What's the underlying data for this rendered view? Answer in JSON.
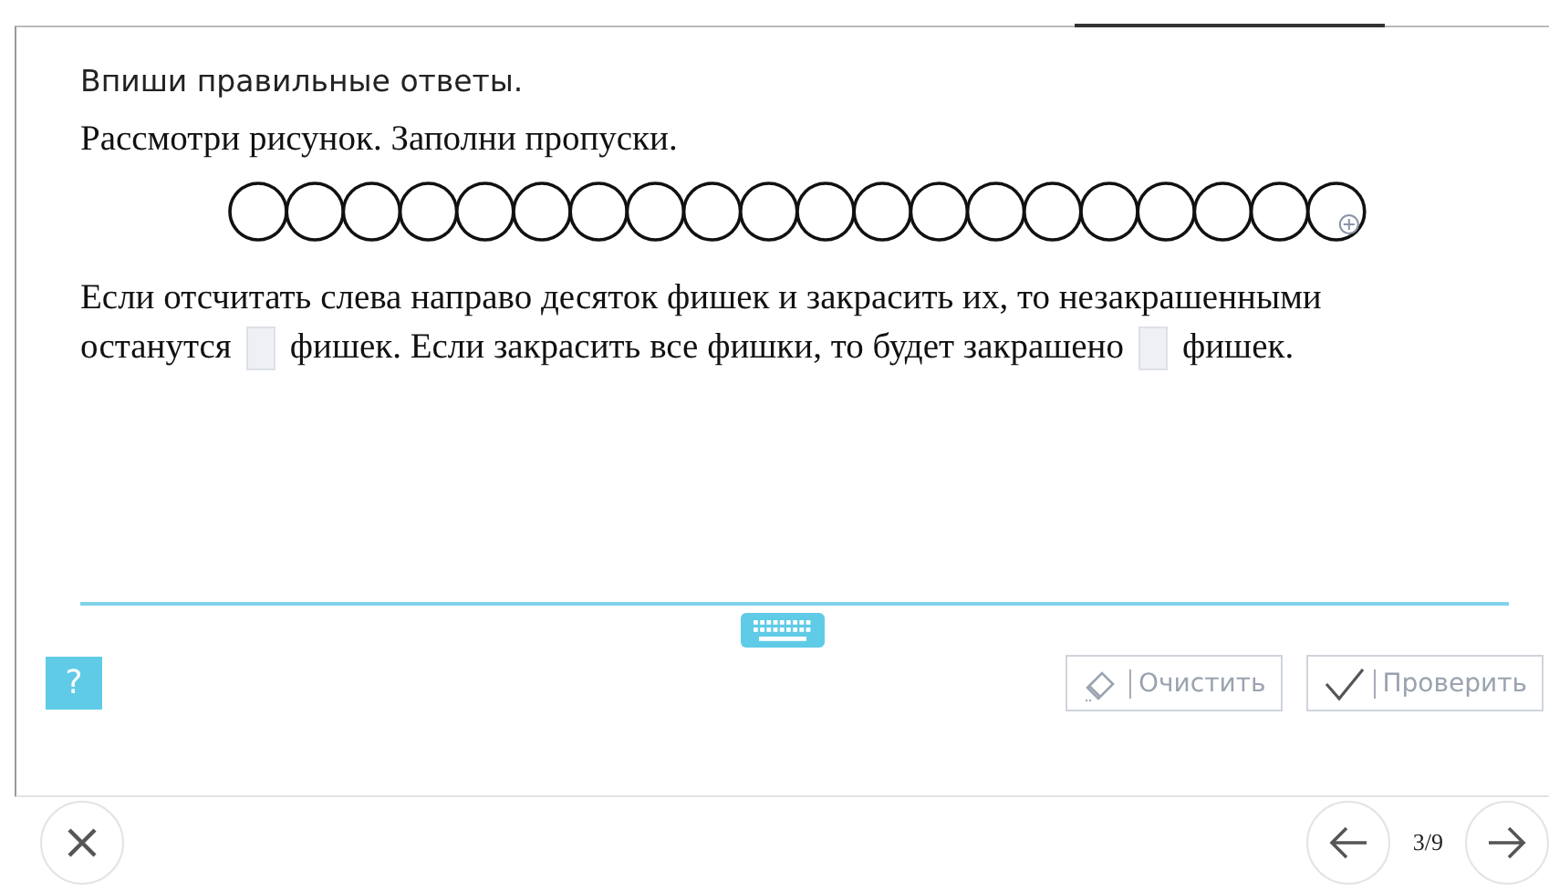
{
  "instruction": "Впиши правильные ответы.",
  "task": {
    "prompt": "Рассмотри рисунок. Заполни пропуски.",
    "counters": [
      {
        "filled": false
      },
      {
        "filled": false
      },
      {
        "filled": false
      },
      {
        "filled": false
      },
      {
        "filled": false
      },
      {
        "filled": false
      },
      {
        "filled": false
      },
      {
        "filled": false
      },
      {
        "filled": false
      },
      {
        "filled": false
      },
      {
        "filled": false
      },
      {
        "filled": false
      },
      {
        "filled": false
      },
      {
        "filled": false
      },
      {
        "filled": false
      },
      {
        "filled": false
      },
      {
        "filled": false
      },
      {
        "filled": false
      },
      {
        "filled": false
      },
      {
        "filled": false
      }
    ],
    "paragraph": [
      [
        {
          "kind": "text",
          "text": "Если отсчитать слева направо десяток фишек и закрасить их, то незакрашенными"
        }
      ],
      [
        {
          "kind": "text",
          "text": "останутся"
        },
        {
          "kind": "blank"
        },
        {
          "kind": "text",
          "text": "фишек. Если закрасить все фишки, то будет закрашено"
        },
        {
          "kind": "blank"
        },
        {
          "kind": "text",
          "text": "фишек."
        }
      ]
    ]
  },
  "help_button": "?",
  "buttons": [
    {
      "kind": "clear",
      "label": "Очистить",
      "disabled": true
    },
    {
      "kind": "check",
      "label": "Проверить",
      "disabled": true
    }
  ],
  "pager": "3/9"
}
